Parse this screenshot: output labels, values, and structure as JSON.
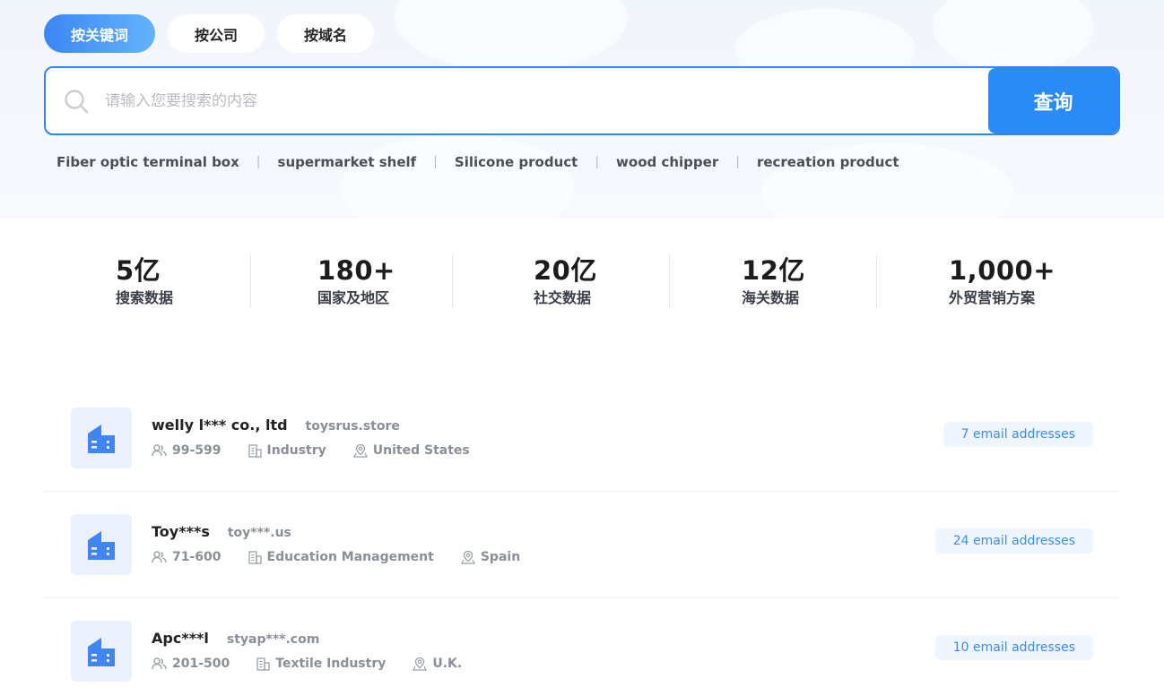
{
  "tabs": [
    {
      "label": "按关键词",
      "active": true
    },
    {
      "label": "按公司",
      "active": false
    },
    {
      "label": "按域名",
      "active": false
    }
  ],
  "search": {
    "placeholder": "请输入您要搜索的内容",
    "value": "",
    "button_label": "查询"
  },
  "hot_tags": [
    "Fiber optic terminal box",
    "supermarket shelf",
    "Silicone product",
    "wood chipper",
    "recreation product"
  ],
  "stats": [
    {
      "value": "5亿",
      "label": "搜索数据"
    },
    {
      "value": "180+",
      "label": "国家及地区"
    },
    {
      "value": "20亿",
      "label": "社交数据"
    },
    {
      "value": "12亿",
      "label": "海关数据"
    },
    {
      "value": "1,000+",
      "label": "外贸营销方案"
    }
  ],
  "companies": [
    {
      "name": "welly l*** co., ltd",
      "domain": "toysrus.store",
      "employees": "99-599",
      "industry": "Industry",
      "location": "United States",
      "emails": "7 email addresses"
    },
    {
      "name": "Toy***s",
      "domain": "toy***.us",
      "employees": "71-600",
      "industry": "Education Management",
      "location": "Spain",
      "emails": "24 email addresses"
    },
    {
      "name": "Apc***l",
      "domain": "styap***.com",
      "employees": "201-500",
      "industry": "Textile Industry",
      "location": "U.K.",
      "emails": "10 email addresses"
    }
  ],
  "colors": {
    "accent": "#2a8bf7",
    "tab_active_start": "#3b86f5",
    "tab_active_end": "#62b4fb",
    "email_badge_bg": "#eef5fe",
    "email_badge_text": "#3a8ef0"
  },
  "icons": {
    "search": "search-icon",
    "company_logo": "building-icon",
    "employees": "people-icon",
    "industry": "industry-building-icon",
    "location": "map-pin-icon"
  }
}
